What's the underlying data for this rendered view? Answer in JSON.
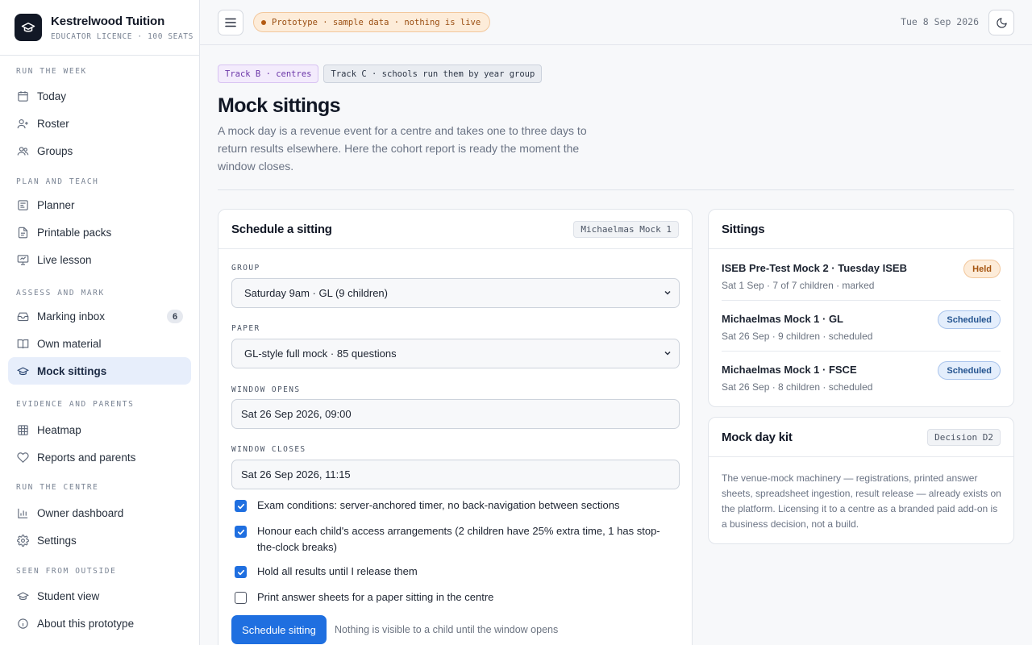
{
  "brand": {
    "name": "Kestrelwood Tuition",
    "sub": "EDUCATOR LICENCE · 100 SEATS"
  },
  "sidebar": {
    "sections": [
      {
        "label": "RUN THE WEEK",
        "items": [
          {
            "label": "Today",
            "icon": "calendar-icon"
          },
          {
            "label": "Roster",
            "icon": "user-plus-icon"
          },
          {
            "label": "Groups",
            "icon": "users-icon"
          }
        ]
      },
      {
        "label": "PLAN AND TEACH",
        "items": [
          {
            "label": "Planner",
            "icon": "planner-icon"
          },
          {
            "label": "Printable packs",
            "icon": "document-icon"
          },
          {
            "label": "Live lesson",
            "icon": "presentation-icon"
          }
        ]
      },
      {
        "label": "ASSESS AND MARK",
        "items": [
          {
            "label": "Marking inbox",
            "icon": "inbox-icon",
            "badge": "6"
          },
          {
            "label": "Own material",
            "icon": "book-icon"
          },
          {
            "label": "Mock sittings",
            "icon": "graduation-cap-icon",
            "active": true
          }
        ]
      },
      {
        "label": "EVIDENCE AND PARENTS",
        "items": [
          {
            "label": "Heatmap",
            "icon": "grid-icon"
          },
          {
            "label": "Reports and parents",
            "icon": "heart-icon"
          }
        ]
      },
      {
        "label": "RUN THE CENTRE",
        "items": [
          {
            "label": "Owner dashboard",
            "icon": "bar-chart-icon"
          },
          {
            "label": "Settings",
            "icon": "gear-icon"
          }
        ]
      },
      {
        "label": "SEEN FROM OUTSIDE",
        "items": [
          {
            "label": "Student view",
            "icon": "graduation-cap-icon"
          },
          {
            "label": "About this prototype",
            "icon": "info-icon"
          }
        ]
      }
    ]
  },
  "topbar": {
    "prototype_notice": "Prototype · sample data · nothing is live",
    "date": "Tue 8 Sep 2026"
  },
  "page": {
    "tags": [
      "Track B · centres",
      "Track C · schools run them by year group"
    ],
    "title": "Mock sittings",
    "description": "A mock day is a revenue event for a centre and takes one to three days to return results elsewhere. Here the cohort report is ready the moment the window closes."
  },
  "form": {
    "title": "Schedule a sitting",
    "chip": "Michaelmas Mock 1",
    "group_label": "GROUP",
    "group_value": "Saturday 9am · GL (9 children)",
    "paper_label": "PAPER",
    "paper_value": "GL-style full mock · 85 questions",
    "opens_label": "WINDOW OPENS",
    "opens_value": "Sat 26 Sep 2026, 09:00",
    "closes_label": "WINDOW CLOSES",
    "closes_value": "Sat 26 Sep 2026, 11:15",
    "checks": [
      {
        "label": "Exam conditions: server-anchored timer, no back-navigation between sections",
        "checked": true
      },
      {
        "label": "Honour each child's access arrangements (2 children have 25% extra time, 1 has stop-the-clock breaks)",
        "checked": true
      },
      {
        "label": "Hold all results until I release them",
        "checked": true
      },
      {
        "label": "Print answer sheets for a paper sitting in the centre",
        "checked": false
      }
    ],
    "submit_label": "Schedule sitting",
    "submit_hint": "Nothing is visible to a child until the window opens"
  },
  "sittings": {
    "title": "Sittings",
    "items": [
      {
        "title": "ISEB Pre-Test Mock 2 · Tuesday ISEB",
        "meta": "Sat 1 Sep · 7 of 7 children · marked",
        "status": "Held"
      },
      {
        "title": "Michaelmas Mock 1 · GL",
        "meta": "Sat 26 Sep · 9 children · scheduled",
        "status": "Scheduled"
      },
      {
        "title": "Michaelmas Mock 1 · FSCE",
        "meta": "Sat 26 Sep · 8 children · scheduled",
        "status": "Scheduled"
      }
    ]
  },
  "kit": {
    "title": "Mock day kit",
    "chip": "Decision D2",
    "body": "The venue-mock machinery — registrations, printed answer sheets, spreadsheet ingestion, result release — already exists on the platform. Licensing it to a centre as a branded paid add-on is a business decision, not a build."
  },
  "colors": {
    "accent": "#1f6fe0",
    "active_nav_bg": "#e7eefb",
    "held": "#a5540f",
    "scheduled": "#23538f"
  }
}
